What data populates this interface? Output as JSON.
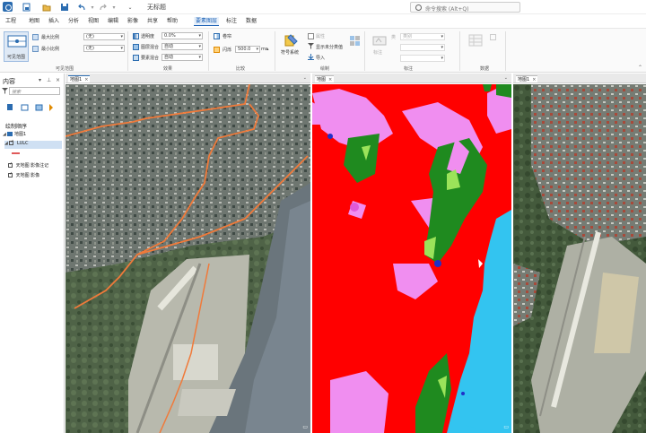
{
  "window": {
    "title": "无标题"
  },
  "command_search": {
    "placeholder": "命令搜索 (Alt+Q)"
  },
  "tabs": [
    "工程",
    "地图",
    "插入",
    "分析",
    "视图",
    "编辑",
    "影像",
    "共享",
    "帮助",
    "要素图层",
    "标注",
    "数据"
  ],
  "active_tab": "要素图层",
  "ribbon": {
    "visible_range": {
      "large_button": "可见范围",
      "max_scale": "最大比例",
      "min_scale": "最小比例",
      "max_value": "(无)",
      "min_value": "(无)",
      "group_label": "可见范围"
    },
    "effects": {
      "transparency_label": "透明度",
      "transparency_value": "0.0%",
      "layer_blend_label": "图层混合",
      "layer_blend_value": "自动",
      "feature_blend_label": "要素混合",
      "feature_blend_value": "自动",
      "group_label": "效果"
    },
    "comparison": {
      "swipe": "卷帘",
      "flicker": "闪烁",
      "flicker_value": "500.0",
      "flicker_unit": "ms",
      "group_label": "比较"
    },
    "drawing": {
      "symbology": "符号系统",
      "attributes": "属性",
      "display_unclassed": "显示未分类值",
      "import": "导入",
      "group_label": "绘制"
    },
    "labeling": {
      "large": "标注",
      "class_label": "类",
      "class_value": "类别",
      "group_label": "标注"
    },
    "data": {
      "group_label": "数据"
    }
  },
  "contents": {
    "title": "内容",
    "search_placeholder": "搜索",
    "drawing_order": "绘制顺序",
    "tree": {
      "map": "地图1",
      "layer": "LULC",
      "basemap1": "天地图 影像注记",
      "basemap2": "天地图 影像"
    }
  },
  "views": [
    {
      "label": "地图1",
      "active": true
    },
    {
      "label": "地图",
      "active": false
    },
    {
      "label": "地图1",
      "active": false
    }
  ],
  "colors": {
    "accent": "#1a5fb4",
    "lulc_built": "#ff0000",
    "lulc_water": "#33c4f0",
    "lulc_vegetation": "#1f8a1f",
    "lulc_bare": "#f08ef0",
    "lulc_grass": "#9be35a",
    "boundary": "#f07a3a"
  },
  "icons": {
    "app": "arcgis-pro-icon",
    "pane_menu": "chevron-down-icon",
    "pin": "pin-icon",
    "close": "close-icon"
  }
}
